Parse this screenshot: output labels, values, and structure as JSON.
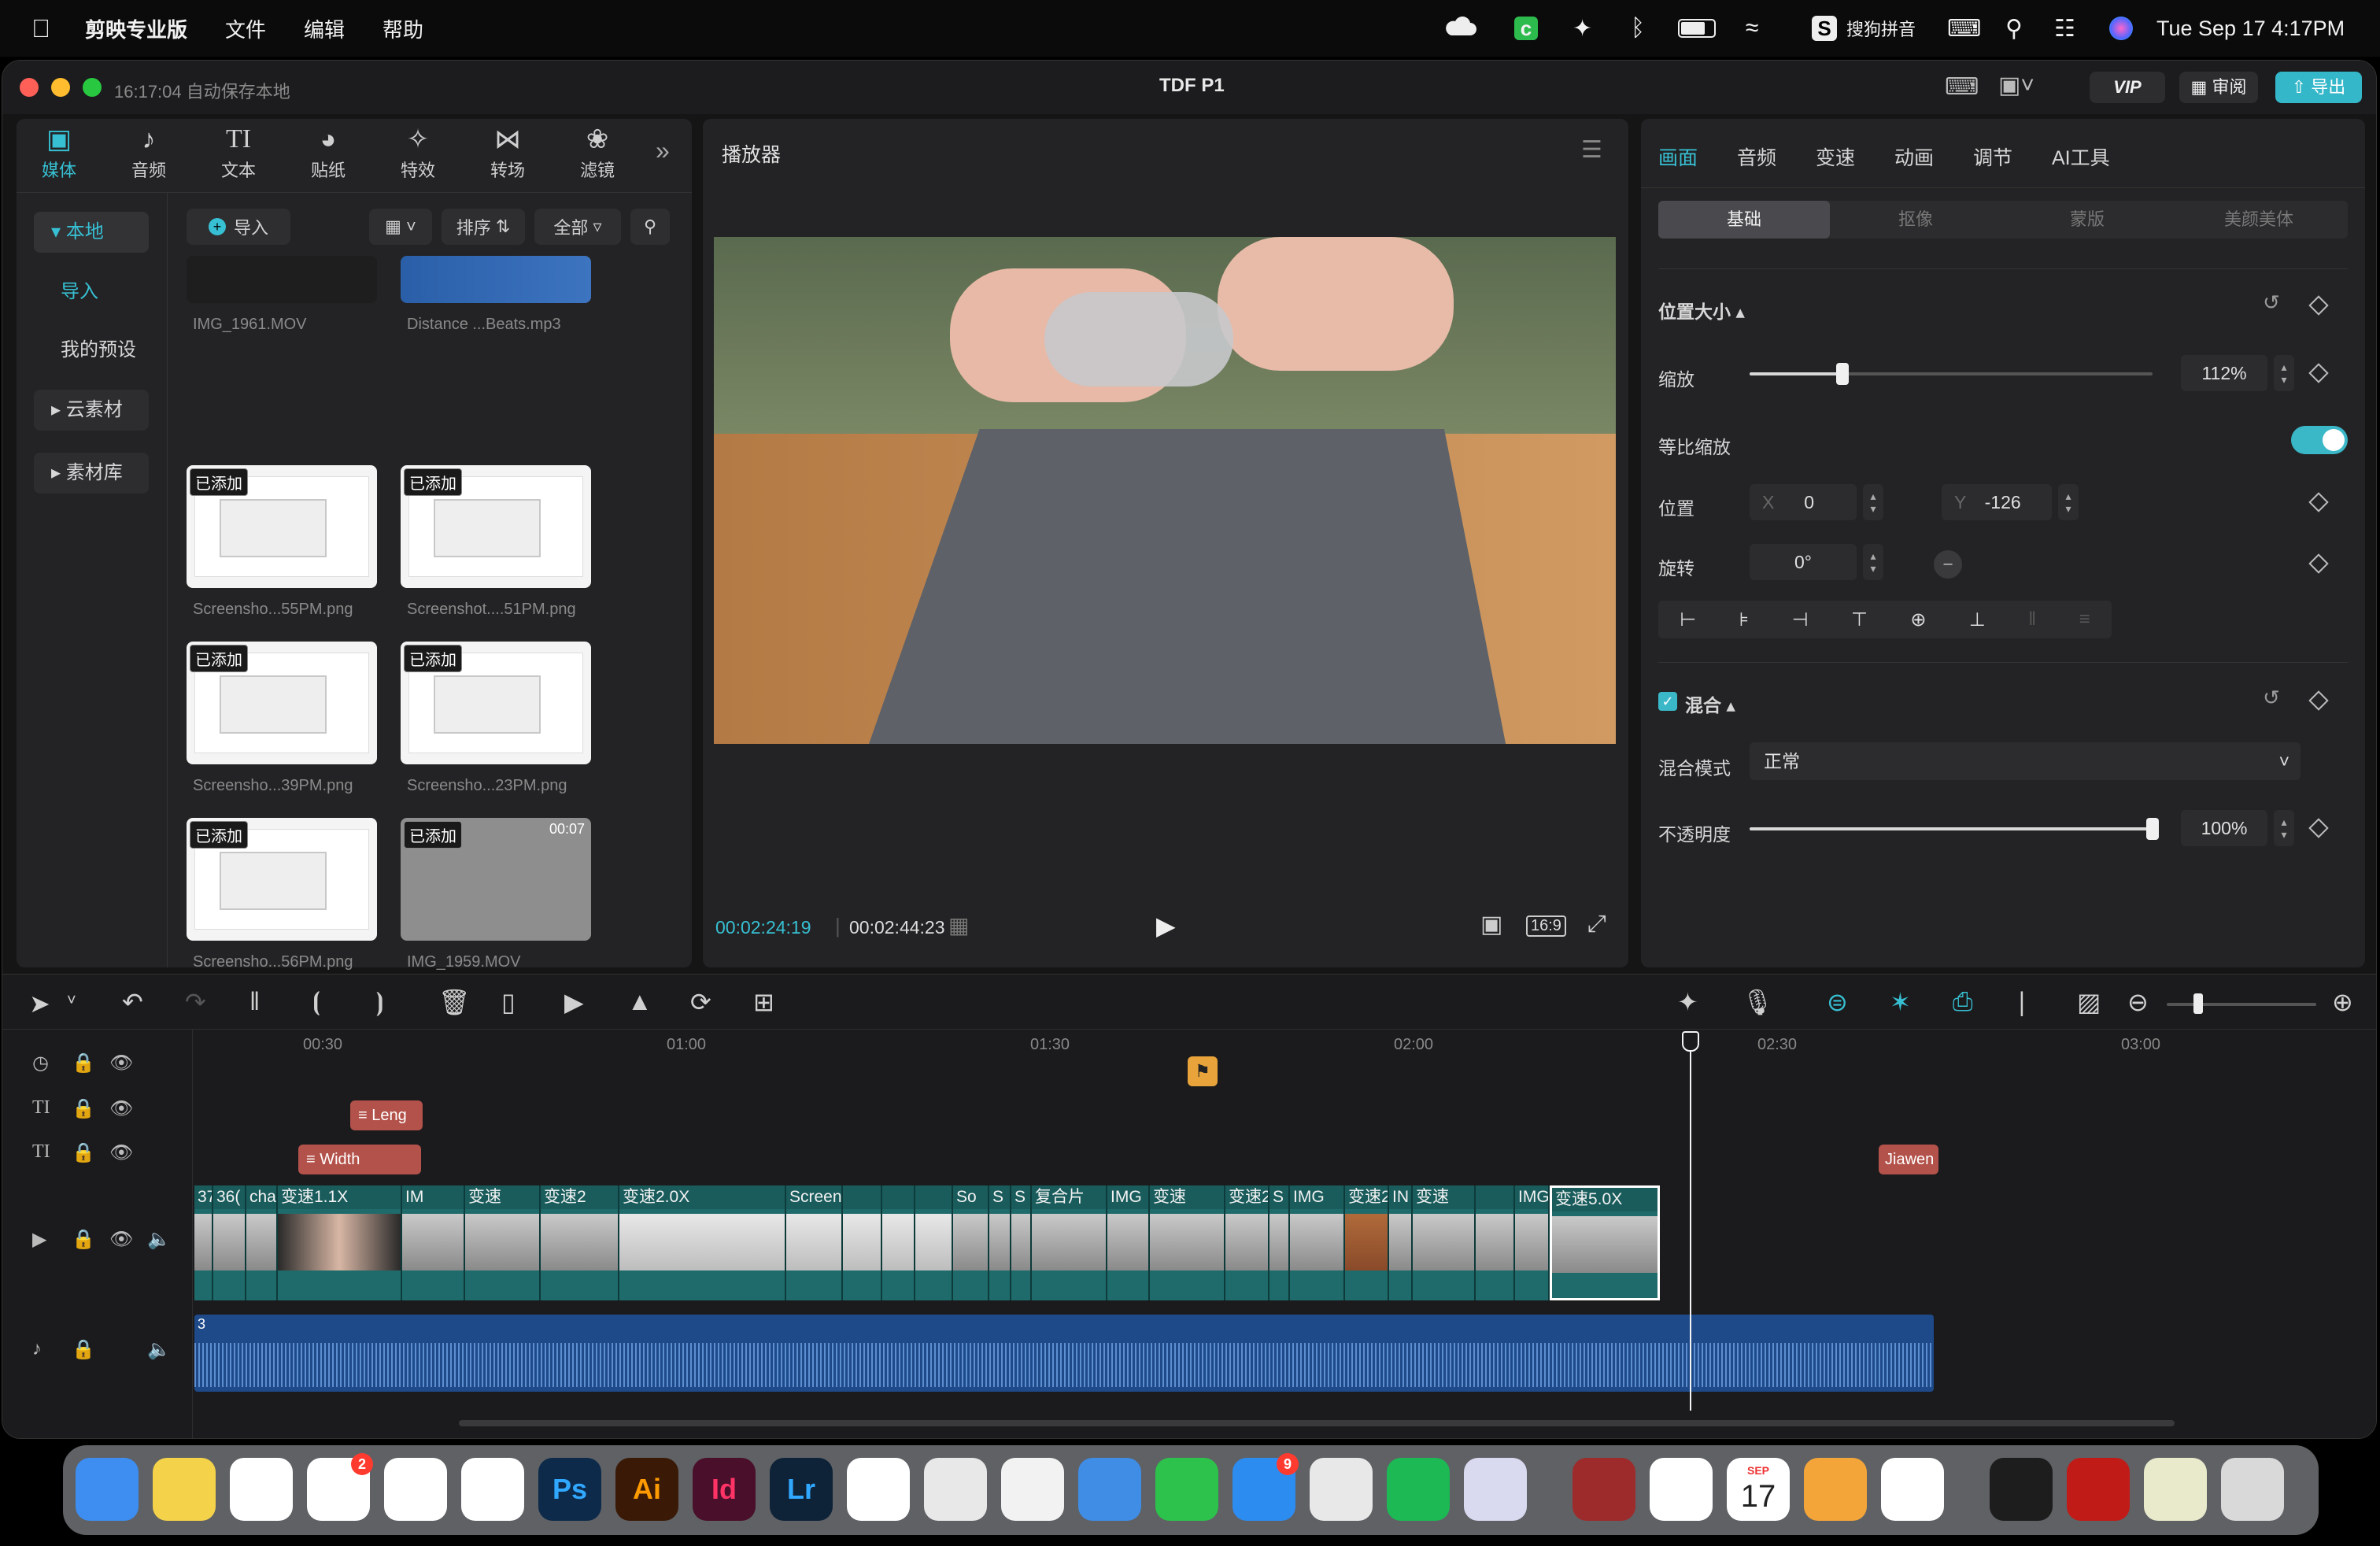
{
  "menubar": {
    "app_name": "剪映专业版",
    "menus": [
      "文件",
      "编辑",
      "帮助"
    ],
    "input_method": "搜狗拼音",
    "clock": "Tue Sep 17  4:17PM"
  },
  "window": {
    "save_status": "16:17:04 自动保存本地",
    "title": "TDF P1",
    "vip_label": "VIP",
    "review_label": "审阅",
    "export_label": "导出"
  },
  "toolbar": {
    "tabs": [
      {
        "label": "媒体",
        "icon": "media-icon"
      },
      {
        "label": "音频",
        "icon": "audio-icon"
      },
      {
        "label": "文本",
        "icon": "text-icon"
      },
      {
        "label": "贴纸",
        "icon": "sticker-icon"
      },
      {
        "label": "特效",
        "icon": "effects-icon"
      },
      {
        "label": "转场",
        "icon": "transition-icon"
      },
      {
        "label": "滤镜",
        "icon": "filter-icon"
      }
    ],
    "more_icon": "chevrons-right-icon"
  },
  "media_sidebar": {
    "local": "本地",
    "import": "导入",
    "presets": "我的预设",
    "cloud": "云素材",
    "library": "素材库"
  },
  "media_toolbar": {
    "import_label": "导入",
    "sort_label": "排序",
    "filter_label": "全部",
    "section_label": "全部"
  },
  "media_items": [
    {
      "name": "IMG_1961.MOV",
      "added": false
    },
    {
      "name": "Distance ...Beats.mp3",
      "added": false
    },
    {
      "name": "Screensho...55PM.png",
      "added": true
    },
    {
      "name": "Screenshot....51PM.png",
      "added": true
    },
    {
      "name": "Screensho...39PM.png",
      "added": true
    },
    {
      "name": "Screensho...23PM.png",
      "added": true
    },
    {
      "name": "Screensho...56PM.png",
      "added": true
    },
    {
      "name": "IMG_1959.MOV",
      "added": true,
      "duration": "00:07"
    }
  ],
  "added_tag": "已添加",
  "player": {
    "title": "播放器",
    "current_time": "00:02:24:19",
    "total_time": "00:02:44:23",
    "aspect": "16:9"
  },
  "inspector": {
    "tabs": [
      "画面",
      "音频",
      "变速",
      "动画",
      "调节",
      "AI工具"
    ],
    "active_tab": "画面",
    "subtabs": [
      "基础",
      "抠像",
      "蒙版",
      "美颜美体"
    ],
    "active_subtab": "基础",
    "position_size": "位置大小",
    "scale_label": "缩放",
    "scale_value": "112%",
    "scale_fraction": 0.23,
    "uniform_label": "等比缩放",
    "position_label": "位置",
    "x_label": "X",
    "x_value": "0",
    "y_label": "Y",
    "y_value": "-126",
    "rotate_label": "旋转",
    "rotate_value": "0°",
    "blend_section": "混合",
    "blend_mode_label": "混合模式",
    "blend_mode_value": "正常",
    "opacity_label": "不透明度",
    "opacity_value": "100%",
    "opacity_fraction": 1.0
  },
  "timeline": {
    "ruler": [
      "00:30",
      "01:00",
      "01:30",
      "02:00",
      "02:30",
      "03:00"
    ],
    "text_clips": [
      "Leng",
      "Width",
      "Jiawen"
    ],
    "clips": [
      "37:",
      "36(",
      "cha",
      "变速1.1X",
      "IM",
      "变速",
      "变速2",
      "变速2.0X",
      "Screen",
      "",
      "",
      "",
      "So",
      "S",
      "S",
      "复合片",
      "IMG",
      "变速",
      "变速2.0X",
      "S",
      "IMG",
      "变速2",
      "IN",
      "变速",
      "",
      "IMG",
      "变速5.0X"
    ],
    "audio_label": "3"
  },
  "dock": [
    {
      "name": "Finder",
      "icon": "finder-icon",
      "color": "#3d8ef0"
    },
    {
      "name": "Notes",
      "icon": "notes-icon",
      "color": "#f4d24a"
    },
    {
      "name": "Freeform",
      "icon": "freeform-icon",
      "color": "#ffffff"
    },
    {
      "name": "Reminders",
      "icon": "reminders-icon",
      "color": "#ffffff",
      "badge": "2"
    },
    {
      "name": "Photos",
      "icon": "photos-icon",
      "color": "#ffffff"
    },
    {
      "name": "Chrome",
      "icon": "chrome-icon",
      "color": "#ffffff"
    },
    {
      "name": "Ps",
      "icon": "photoshop-icon",
      "color": "#0d2a4a"
    },
    {
      "name": "Ai",
      "icon": "illustrator-icon",
      "color": "#3a1a06"
    },
    {
      "name": "Id",
      "icon": "indesign-icon",
      "color": "#4a0f2a"
    },
    {
      "name": "Lr",
      "icon": "lightroom-icon",
      "color": "#0e2238"
    },
    {
      "name": "VS Code",
      "icon": "vscode-icon",
      "color": "#ffffff"
    },
    {
      "name": "Inkscape",
      "icon": "inkscape-icon",
      "color": "#e8e8e8"
    },
    {
      "name": "Script Editor",
      "icon": "script-icon",
      "color": "#f2f2f2"
    },
    {
      "name": "Keynote",
      "icon": "keynote-icon",
      "color": "#3f8de5"
    },
    {
      "name": "WeChat",
      "icon": "wechat-icon",
      "color": "#2dc24b"
    },
    {
      "name": "App Store",
      "icon": "appstore-icon",
      "color": "#2d8cf0",
      "badge": "9"
    },
    {
      "name": "AutoCAD",
      "icon": "autocad-icon",
      "color": "#e8e8e8"
    },
    {
      "name": "Spotify",
      "icon": "spotify-icon",
      "color": "#1db954"
    },
    {
      "name": "Launchpad",
      "icon": "launchpad-icon",
      "color": "#d9d9f0"
    },
    {
      "name": "Dictionary",
      "icon": "dictionary-icon",
      "color": "#9e2b2b"
    },
    {
      "name": "Acrobat",
      "icon": "acrobat-icon",
      "color": "#ffffff"
    },
    {
      "name": "Calendar",
      "icon": "calendar-icon",
      "color": "#ffffff",
      "month": "SEP",
      "day": "17"
    },
    {
      "name": "Pages",
      "icon": "pages-icon",
      "color": "#f4a53a"
    },
    {
      "name": "CapCut",
      "icon": "capcut-icon",
      "color": "#ffffff"
    },
    {
      "name": "Activity",
      "icon": "activity-monitor-icon",
      "color": "#1d1d1d"
    },
    {
      "name": "PDF",
      "icon": "pdf-folder-icon",
      "color": "#c11b17"
    },
    {
      "name": "Welcome",
      "icon": "welcome-icon",
      "color": "#e8eacb"
    },
    {
      "name": "Trash",
      "icon": "trash-icon",
      "color": "#d9d9d9"
    }
  ],
  "colors": {
    "accent": "#3ab8c8",
    "timeline_clip": "#1f6b6b",
    "audio_clip": "#1e4a8a",
    "text_clip": "#b3524a"
  }
}
